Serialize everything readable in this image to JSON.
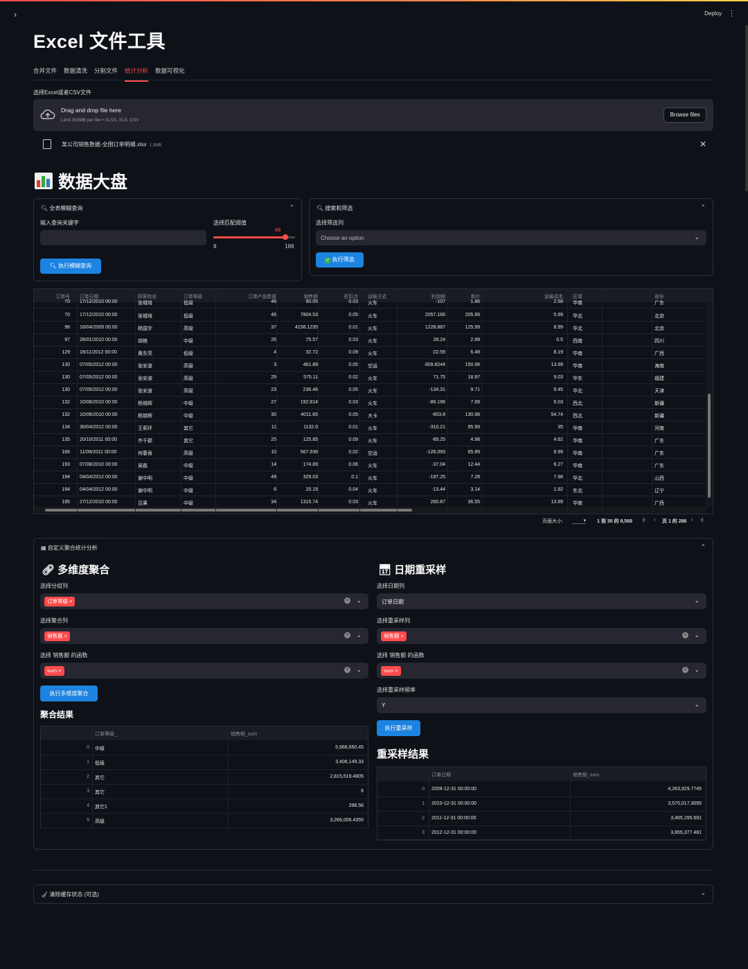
{
  "header": {
    "deploy_label": "Deploy",
    "menu_icon": "kebab-menu-icon",
    "sidebar_icon": "chevron-right-icon"
  },
  "app": {
    "title": "Excel 文件工具"
  },
  "tabs": [
    {
      "label": "合并文件"
    },
    {
      "label": "数据清洗"
    },
    {
      "label": "分割文件"
    },
    {
      "label": "统计分析",
      "active": true
    },
    {
      "label": "数据可视化"
    }
  ],
  "uploader": {
    "label": "选择Excel或者CSV文件",
    "drag_text": "Drag and drop file here",
    "limit_text": "Limit 300MB per file • XLSX, XLS, CSV",
    "browse_label": "Browse files",
    "file_name": "某公司销售数据-全国订单明细.xlsx",
    "file_size": "1.3MB"
  },
  "dashboard": {
    "title": "数据大盘"
  },
  "fuzzy": {
    "header": "全表模糊查询",
    "keyword_label": "输入查询关键字",
    "keyword_value": "",
    "threshold_label": "选择匹配阈值",
    "threshold_value": 88,
    "threshold_value_text": "88",
    "threshold_min": "0",
    "threshold_max": "100",
    "button": "执行模糊查询"
  },
  "filter": {
    "header": "搜索和筛选",
    "column_label": "选择筛选列",
    "placeholder": "Choose an option",
    "button": "执行筛选"
  },
  "grid": {
    "columns": [
      "订单号",
      "订单日期",
      "顾客姓名",
      "订单等级",
      "订单产品数量",
      "销售额",
      "折扣点",
      "运输方式",
      "利润额",
      "单价",
      "运输成本",
      "区域",
      "省份"
    ],
    "partial_row": [
      "70",
      "17/12/2010 00:00",
      "张城培",
      "低级",
      "46",
      "90.05",
      "0.03",
      "火车",
      "-107",
      "1.86",
      "2.58",
      "华南",
      "广东"
    ],
    "rows": [
      [
        "70",
        "17/12/2010 00:00",
        "张城培",
        "低级",
        "46",
        "7804.53",
        "0.05",
        "火车",
        "2057.166",
        "205.99",
        "5.99",
        "华北",
        "北京"
      ],
      [
        "96",
        "16/04/2009 00:00",
        "杨国宇",
        "高级",
        "37",
        "4158.1235",
        "0.01",
        "火车",
        "1228.887",
        "125.99",
        "8.99",
        "华北",
        "北京"
      ],
      [
        "97",
        "28/01/2010 00:00",
        "胡艳",
        "中级",
        "26",
        "75.57",
        "0.03",
        "火车",
        "28.24",
        "2.89",
        "0.5",
        "西南",
        "四川"
      ],
      [
        "129",
        "18/11/2012 00:00",
        "黄东亮",
        "低级",
        "4",
        "32.72",
        "0.09",
        "火车",
        "-22.59",
        "6.48",
        "8.19",
        "华南",
        "广西"
      ],
      [
        "130",
        "07/05/2012 00:00",
        "张安波",
        "高级",
        "3",
        "461.89",
        "0.05",
        "空运",
        "-309.8244",
        "150.98",
        "13.99",
        "华南",
        "海南"
      ],
      [
        "130",
        "07/05/2012 00:00",
        "张安波",
        "高级",
        "29",
        "575.11",
        "0.02",
        "火车",
        "71.75",
        "18.97",
        "9.03",
        "华东",
        "福建"
      ],
      [
        "130",
        "07/05/2012 00:00",
        "张安波",
        "高级",
        "23",
        "236.46",
        "0.05",
        "火车",
        "-134.31",
        "9.71",
        "9.45",
        "华北",
        "天津"
      ],
      [
        "132",
        "10/06/2010 00:00",
        "杨锡辉",
        "中级",
        "27",
        "192.814",
        "0.03",
        "火车",
        "-86.196",
        "7.99",
        "5.03",
        "西北",
        "新疆"
      ],
      [
        "132",
        "10/06/2010 00:00",
        "杨锡辉",
        "中级",
        "30",
        "4011.65",
        "0.05",
        "大卡",
        "-603.8",
        "130.98",
        "54.74",
        "西北",
        "新疆"
      ],
      [
        "134",
        "30/04/2012 00:00",
        "王莉环",
        "其它",
        "11",
        "1132.6",
        "0.01",
        "火车",
        "-310.21",
        "95.99",
        "35",
        "华南",
        "河南"
      ],
      [
        "135",
        "20/10/2011 00:00",
        "齐千郡",
        "其它",
        "25",
        "125.85",
        "0.09",
        "火车",
        "-89.25",
        "4.98",
        "4.62",
        "华南",
        "广东"
      ],
      [
        "166",
        "11/09/2011 00:00",
        "何春香",
        "高级",
        "10",
        "567.936",
        "0.02",
        "空运",
        "-126.093",
        "65.99",
        "8.99",
        "华南",
        "广东"
      ],
      [
        "193",
        "07/08/2010 00:00",
        "吴磊",
        "中级",
        "14",
        "174.89",
        "0.06",
        "火车",
        "-37.04",
        "12.44",
        "6.27",
        "华南",
        "广东"
      ],
      [
        "194",
        "04/04/2012 00:00",
        "谢中明",
        "中级",
        "49",
        "329.03",
        "0.1",
        "火车",
        "-197.25",
        "7.28",
        "7.98",
        "华北",
        "山西"
      ],
      [
        "194",
        "04/04/2012 00:00",
        "谢中明",
        "中级",
        "6",
        "20.19",
        "0.04",
        "火车",
        "-13.44",
        "3.14",
        "1.92",
        "东北",
        "辽宁"
      ],
      [
        "195",
        "27/12/2010 00:00",
        "吕果",
        "中级",
        "34",
        "1315.74",
        "0.03",
        "火车",
        "260.87",
        "36.55",
        "13.89",
        "华南",
        "广西"
      ]
    ],
    "page_size_label": "页面大小:",
    "range_text": "1 到 30 的 8,568",
    "page_text": "页 1 的 286"
  },
  "custom": {
    "header": "自定义聚合统计分析",
    "multi": {
      "title": "多维度聚合",
      "group_label": "选择分组列",
      "group_tag": "订单等级",
      "agg_label": "选择聚合列",
      "agg_tag": "销售额",
      "func_label": "选择 销售额 的函数",
      "func_tag": "sum",
      "button": "执行多维度聚合",
      "result_title": "聚合结果",
      "columns": [
        "订单等级_",
        "销售额_sum"
      ],
      "rows": [
        [
          "0",
          "中级",
          "5,666,650.45"
        ],
        [
          "1",
          "低级",
          "3,406,149.33"
        ],
        [
          "2",
          "其它",
          "2,815,519.4805"
        ],
        [
          "3",
          "其它",
          "6"
        ],
        [
          "4",
          "其它1",
          "288.56"
        ],
        [
          "5",
          "高级",
          "3,266,006.4355"
        ]
      ]
    },
    "resample": {
      "title": "日期重采样",
      "date_label": "选择日期列",
      "date_value": "订单日期",
      "col_label": "选择重采样列",
      "col_tag": "销售额",
      "func_label": "选择 销售额 的函数",
      "func_tag": "sum",
      "freq_label": "选择重采样频率",
      "freq_value": "Y",
      "button": "执行重采样",
      "result_title": "重采样结果",
      "columns": [
        "订单日期",
        "销售额_sum"
      ],
      "rows": [
        [
          "0",
          "2009-12-31 00:00:00",
          "4,263,929.7745"
        ],
        [
          "1",
          "2010-12-31 00:00:00",
          "3,570,017.3095"
        ],
        [
          "2",
          "2011-12-31 00:00:00",
          "3,465,295.691"
        ],
        [
          "3",
          "2012-12-31 00:00:00",
          "3,855,377.481"
        ]
      ]
    }
  },
  "cache": {
    "header": "清除缓存状态 (可选)"
  },
  "colors": {
    "accent": "#ff4b4b",
    "primary": "#1c83e1",
    "background": "#0e1117",
    "widget": "#262730"
  }
}
